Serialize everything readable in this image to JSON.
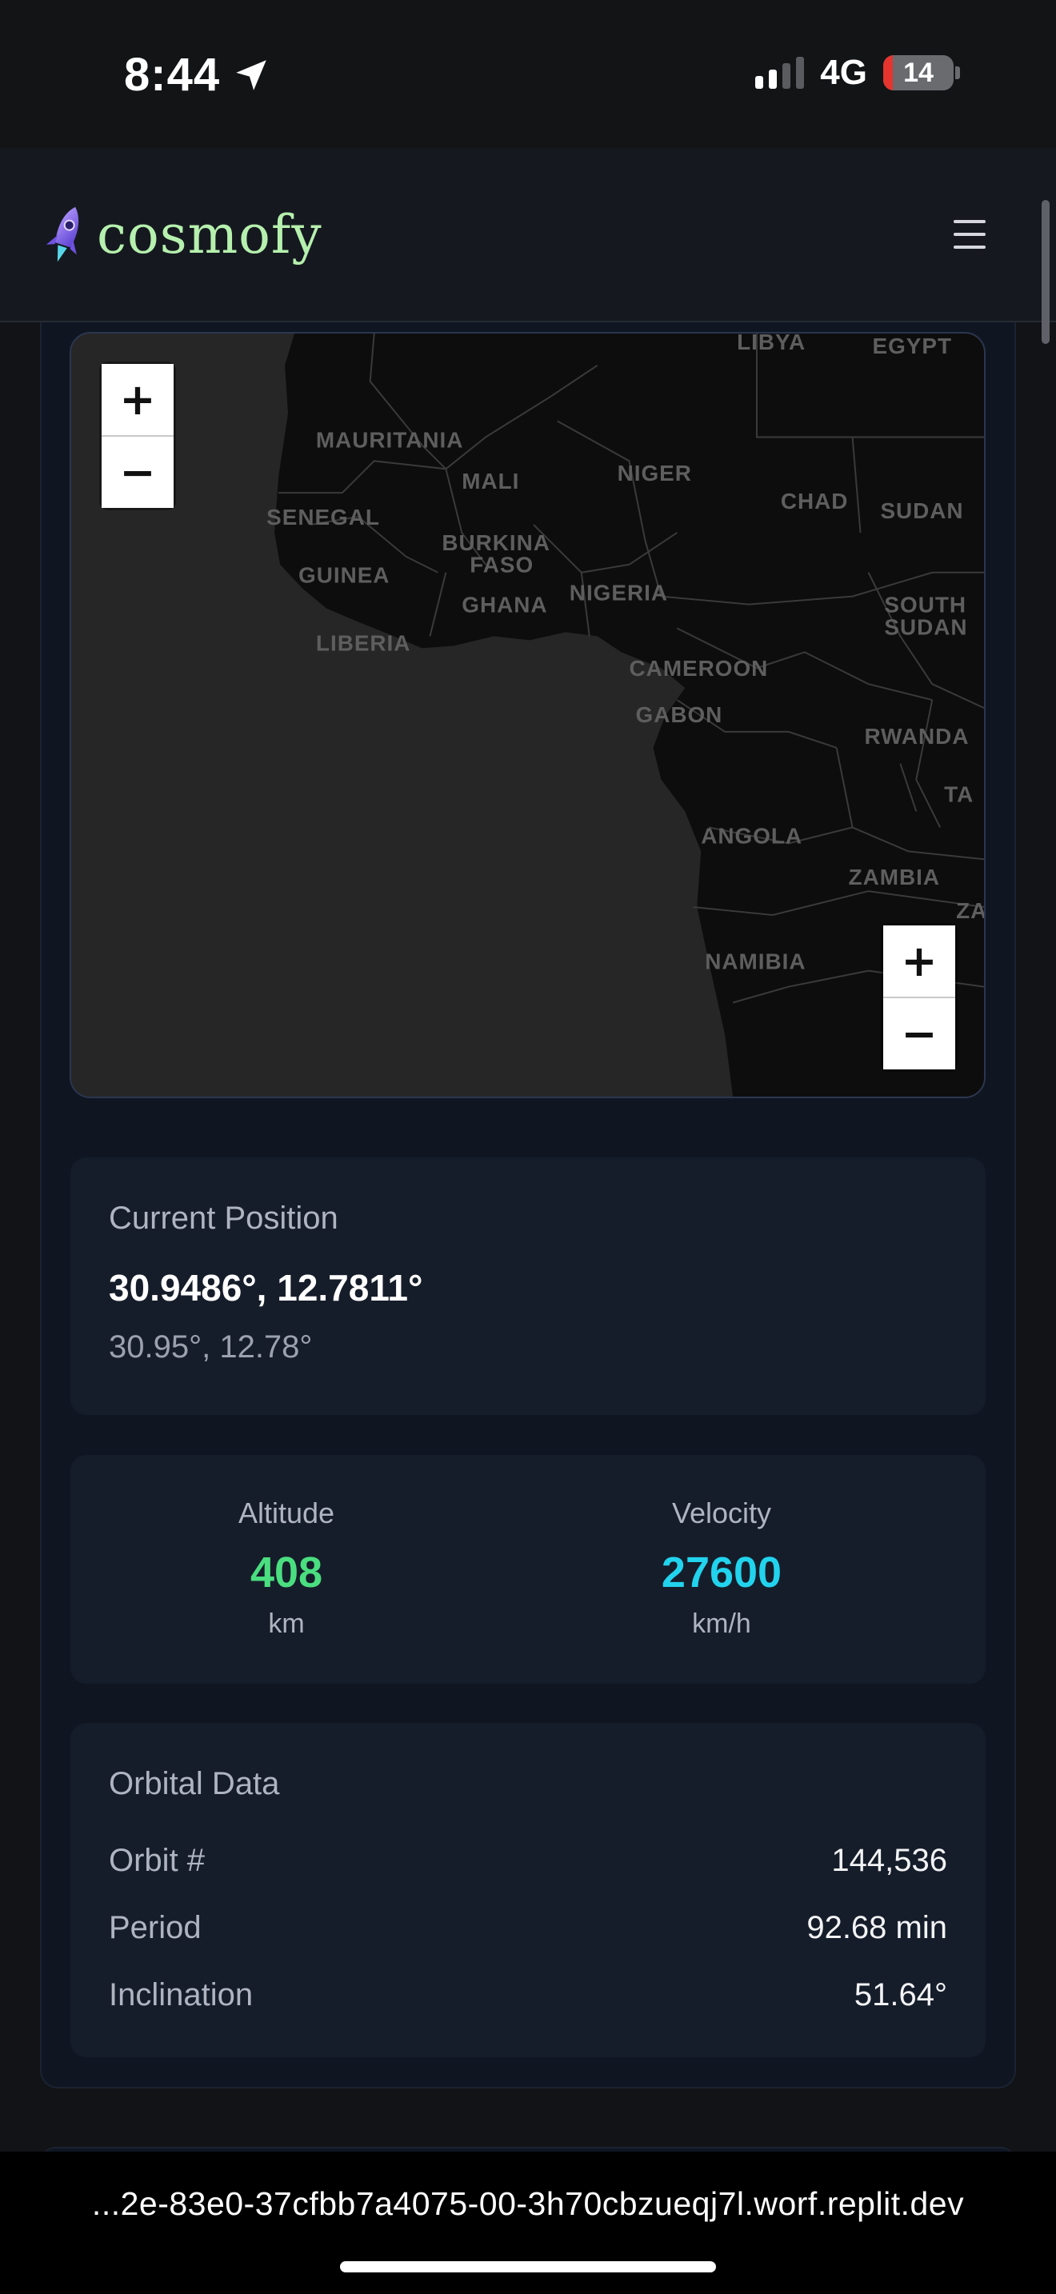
{
  "status_bar": {
    "time": "8:44",
    "network": "4G",
    "battery": "14",
    "battery_level": 0.14,
    "signal_bars_active": 2,
    "signal_bars_total": 4
  },
  "app": {
    "name": "cosmofy",
    "logo_icon": "rocket-icon",
    "menu_icon": "hamburger-menu-icon",
    "colors": {
      "logo_text": "#b6f0ae",
      "altitude": "#4ade80",
      "velocity": "#22d3ee"
    }
  },
  "map": {
    "zoom_in_label": "+",
    "zoom_out_label": "−",
    "labels": [
      {
        "name": "LIBYA"
      },
      {
        "name": "EGYPT"
      },
      {
        "name": "MAURITANIA"
      },
      {
        "name": "MALI"
      },
      {
        "name": "NIGER"
      },
      {
        "name": "CHAD"
      },
      {
        "name": "SUDAN"
      },
      {
        "name": "SENEGAL"
      },
      {
        "name": "BURKINA"
      },
      {
        "name": "FASO"
      },
      {
        "name": "GUINEA"
      },
      {
        "name": "GHANA"
      },
      {
        "name": "NIGERIA"
      },
      {
        "name": "SOUTH"
      },
      {
        "name": "SUDAN"
      },
      {
        "name": "LIBERIA"
      },
      {
        "name": "CAMEROON"
      },
      {
        "name": "GABON"
      },
      {
        "name": "RWANDA"
      },
      {
        "name": "TA"
      },
      {
        "name": "ANGOLA"
      },
      {
        "name": "ZAMBIA"
      },
      {
        "name": "ZA"
      },
      {
        "name": "NAMIBIA"
      }
    ]
  },
  "position": {
    "title": "Current Position",
    "coordinates": "30.9486°, 12.7811°",
    "coordinates_short": "30.95°, 12.78°"
  },
  "stats": {
    "altitude": {
      "label": "Altitude",
      "value": "408",
      "unit": "km"
    },
    "velocity": {
      "label": "Velocity",
      "value": "27600",
      "unit": "km/h"
    }
  },
  "orbital": {
    "title": "Orbital Data",
    "rows": [
      {
        "label": "Orbit #",
        "value": "144,536"
      },
      {
        "label": "Period",
        "value": "92.68 min"
      },
      {
        "label": "Inclination",
        "value": "51.64°"
      }
    ]
  },
  "browser": {
    "url": "...2e-83e0-37cfbb7a4075-00-3h70cbzueqj7l.worf.replit.dev"
  }
}
